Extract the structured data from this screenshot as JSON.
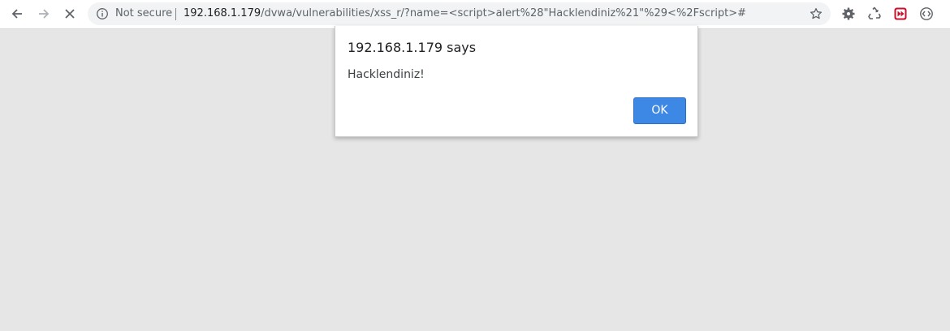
{
  "browser": {
    "security_label": "Not secure",
    "url_host": "192.168.1.179",
    "url_path": "/dvwa/vulnerabilities/xss_r/?name=<script>alert%28\"Hacklendiniz%21\"%29<%2Fscript>#",
    "icons": {
      "back": "back-arrow-icon",
      "forward": "forward-arrow-icon",
      "stop": "stop-loading-icon",
      "info": "info-icon",
      "bookmark": "star-icon",
      "ext1": "gear-icon",
      "ext2": "recycle-icon",
      "ext3": "media-forward-icon",
      "ext4": "code-icon"
    }
  },
  "alert": {
    "title": "192.168.1.179 says",
    "message": "Hacklendiniz!",
    "ok_label": "OK",
    "accent_color": "#3d88e5"
  },
  "page": {
    "background_color": "#e6e6e6"
  }
}
